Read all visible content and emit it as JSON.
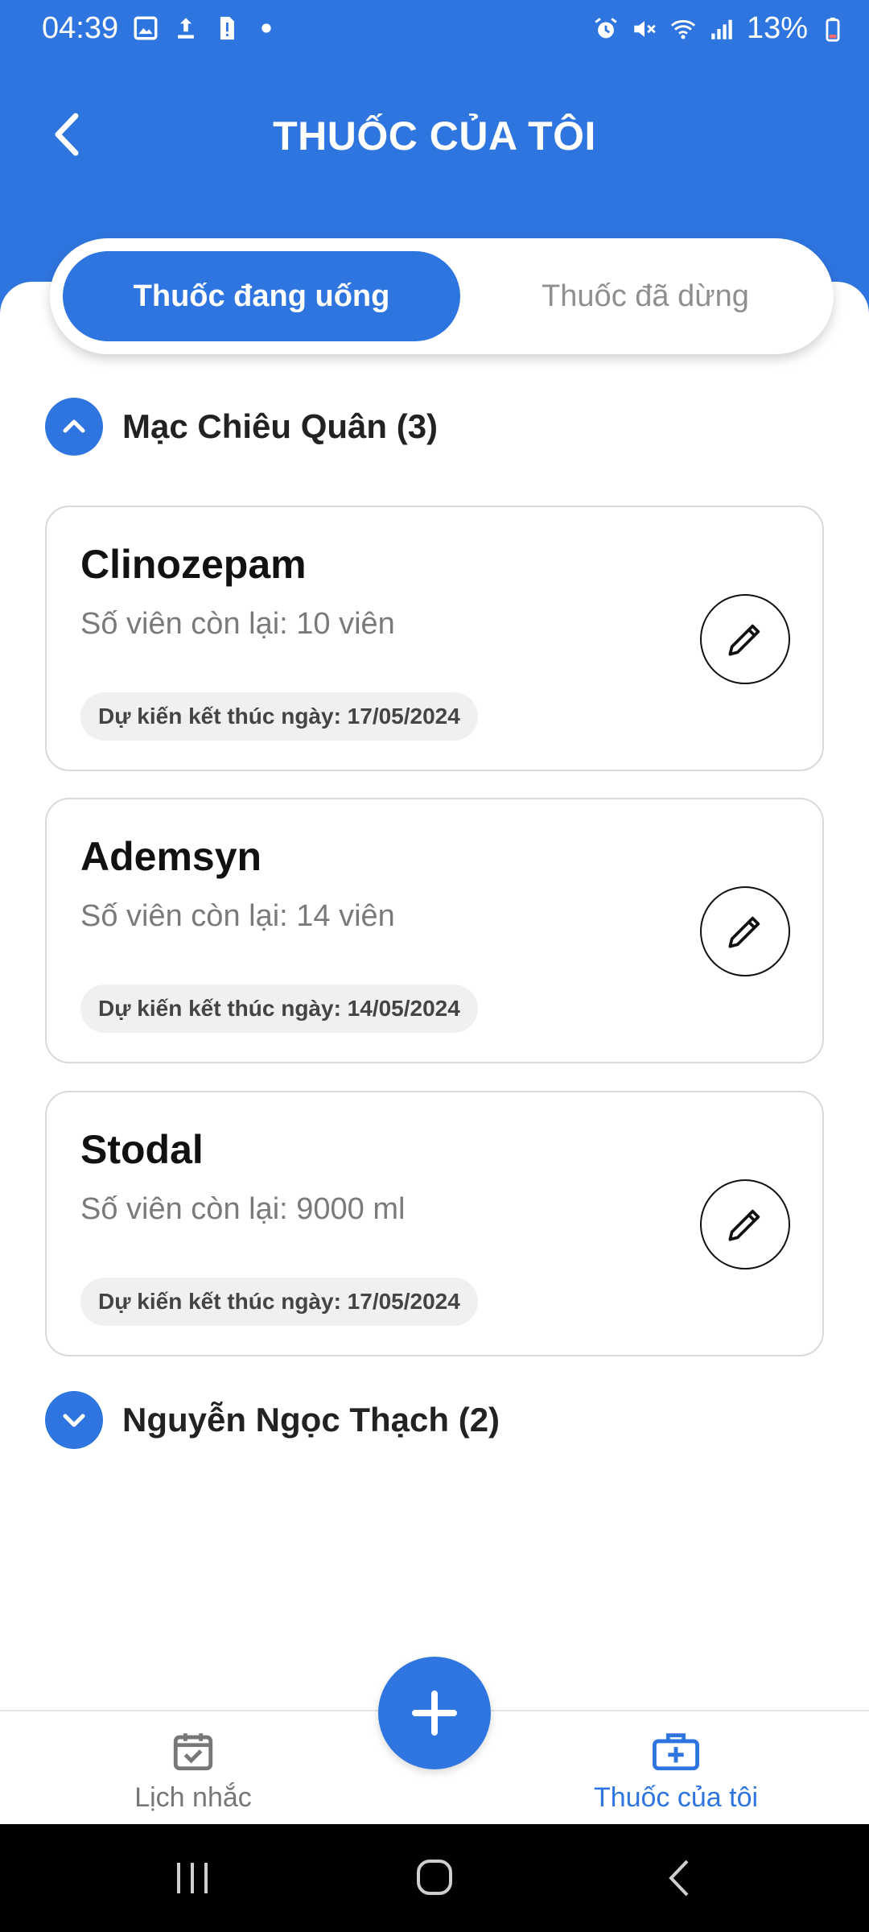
{
  "status_bar": {
    "time": "04:39",
    "battery": "13%",
    "left_icons": [
      "image-icon",
      "upload-icon",
      "alert-card-icon",
      "dot-icon"
    ],
    "right_icons": [
      "alarm-icon",
      "mute-icon",
      "wifi-icon",
      "signal-icon",
      "battery-icon"
    ]
  },
  "header": {
    "title": "THUỐC CỦA TÔI",
    "back_icon": "chevron-left-icon"
  },
  "tabs": {
    "active": "Thuốc đang uống",
    "inactive": "Thuốc đã dừng"
  },
  "groups": [
    {
      "title": "Mạc Chiêu Quân (3)",
      "expanded": true,
      "toggle_icon": "chevron-up-icon",
      "medicines": [
        {
          "name": "Clinozepam",
          "remaining": "Số viên còn lại: 10 viên",
          "end_date": "Dự kiến kết thúc ngày: 17/05/2024"
        },
        {
          "name": "Ademsyn",
          "remaining": "Số viên còn lại: 14 viên",
          "end_date": "Dự kiến kết thúc ngày: 14/05/2024"
        },
        {
          "name": "Stodal",
          "remaining": "Số viên còn lại: 9000 ml",
          "end_date": "Dự kiến kết thúc ngày: 17/05/2024"
        }
      ]
    },
    {
      "title": "Nguyễn Ngọc Thạch (2)",
      "expanded": false,
      "toggle_icon": "chevron-down-icon"
    }
  ],
  "bottom_nav": {
    "left_label": "Lịch nhắc",
    "left_icon": "calendar-check-icon",
    "right_label": "Thuốc của tôi",
    "right_icon": "medical-kit-icon",
    "fab_icon": "plus-icon"
  },
  "colors": {
    "primary": "#2F75E0",
    "text_dark": "#111111",
    "text_muted": "#7a7a7a",
    "chip_bg": "#f0f0f0"
  }
}
